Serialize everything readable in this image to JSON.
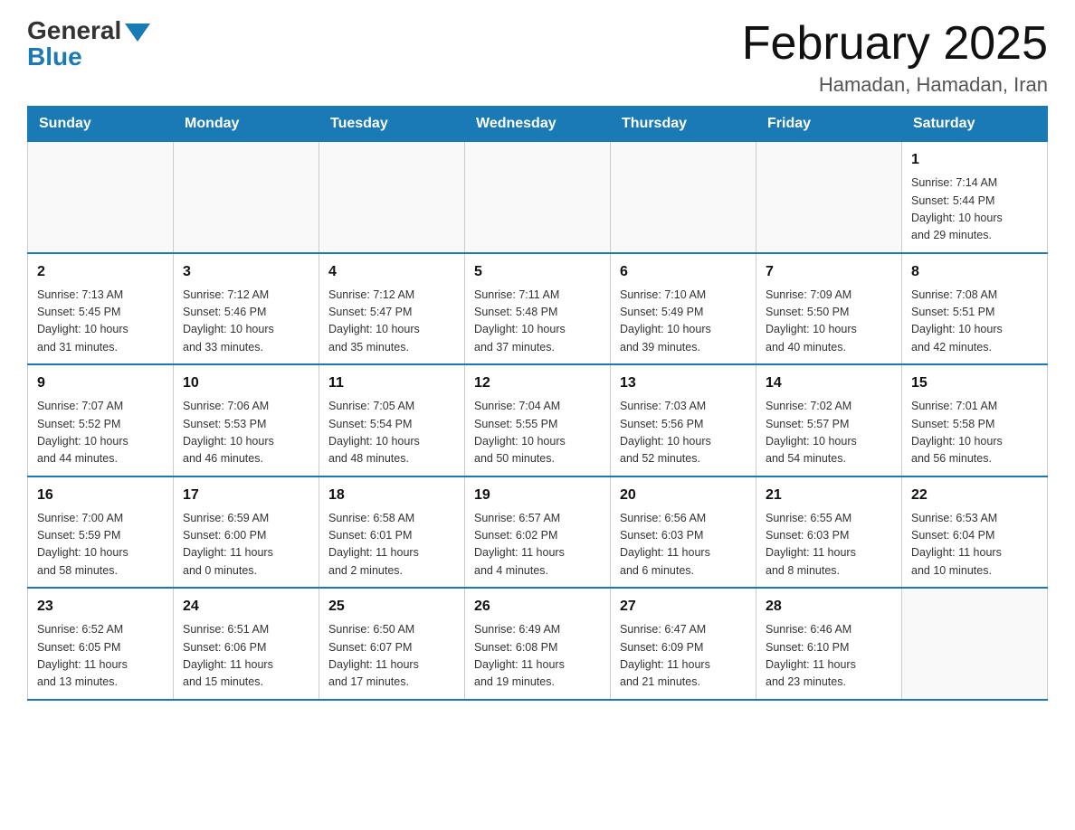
{
  "header": {
    "logo_general": "General",
    "logo_blue": "Blue",
    "month_title": "February 2025",
    "location": "Hamadan, Hamadan, Iran"
  },
  "days_of_week": [
    "Sunday",
    "Monday",
    "Tuesday",
    "Wednesday",
    "Thursday",
    "Friday",
    "Saturday"
  ],
  "weeks": [
    [
      {
        "day": "",
        "info": ""
      },
      {
        "day": "",
        "info": ""
      },
      {
        "day": "",
        "info": ""
      },
      {
        "day": "",
        "info": ""
      },
      {
        "day": "",
        "info": ""
      },
      {
        "day": "",
        "info": ""
      },
      {
        "day": "1",
        "info": "Sunrise: 7:14 AM\nSunset: 5:44 PM\nDaylight: 10 hours\nand 29 minutes."
      }
    ],
    [
      {
        "day": "2",
        "info": "Sunrise: 7:13 AM\nSunset: 5:45 PM\nDaylight: 10 hours\nand 31 minutes."
      },
      {
        "day": "3",
        "info": "Sunrise: 7:12 AM\nSunset: 5:46 PM\nDaylight: 10 hours\nand 33 minutes."
      },
      {
        "day": "4",
        "info": "Sunrise: 7:12 AM\nSunset: 5:47 PM\nDaylight: 10 hours\nand 35 minutes."
      },
      {
        "day": "5",
        "info": "Sunrise: 7:11 AM\nSunset: 5:48 PM\nDaylight: 10 hours\nand 37 minutes."
      },
      {
        "day": "6",
        "info": "Sunrise: 7:10 AM\nSunset: 5:49 PM\nDaylight: 10 hours\nand 39 minutes."
      },
      {
        "day": "7",
        "info": "Sunrise: 7:09 AM\nSunset: 5:50 PM\nDaylight: 10 hours\nand 40 minutes."
      },
      {
        "day": "8",
        "info": "Sunrise: 7:08 AM\nSunset: 5:51 PM\nDaylight: 10 hours\nand 42 minutes."
      }
    ],
    [
      {
        "day": "9",
        "info": "Sunrise: 7:07 AM\nSunset: 5:52 PM\nDaylight: 10 hours\nand 44 minutes."
      },
      {
        "day": "10",
        "info": "Sunrise: 7:06 AM\nSunset: 5:53 PM\nDaylight: 10 hours\nand 46 minutes."
      },
      {
        "day": "11",
        "info": "Sunrise: 7:05 AM\nSunset: 5:54 PM\nDaylight: 10 hours\nand 48 minutes."
      },
      {
        "day": "12",
        "info": "Sunrise: 7:04 AM\nSunset: 5:55 PM\nDaylight: 10 hours\nand 50 minutes."
      },
      {
        "day": "13",
        "info": "Sunrise: 7:03 AM\nSunset: 5:56 PM\nDaylight: 10 hours\nand 52 minutes."
      },
      {
        "day": "14",
        "info": "Sunrise: 7:02 AM\nSunset: 5:57 PM\nDaylight: 10 hours\nand 54 minutes."
      },
      {
        "day": "15",
        "info": "Sunrise: 7:01 AM\nSunset: 5:58 PM\nDaylight: 10 hours\nand 56 minutes."
      }
    ],
    [
      {
        "day": "16",
        "info": "Sunrise: 7:00 AM\nSunset: 5:59 PM\nDaylight: 10 hours\nand 58 minutes."
      },
      {
        "day": "17",
        "info": "Sunrise: 6:59 AM\nSunset: 6:00 PM\nDaylight: 11 hours\nand 0 minutes."
      },
      {
        "day": "18",
        "info": "Sunrise: 6:58 AM\nSunset: 6:01 PM\nDaylight: 11 hours\nand 2 minutes."
      },
      {
        "day": "19",
        "info": "Sunrise: 6:57 AM\nSunset: 6:02 PM\nDaylight: 11 hours\nand 4 minutes."
      },
      {
        "day": "20",
        "info": "Sunrise: 6:56 AM\nSunset: 6:03 PM\nDaylight: 11 hours\nand 6 minutes."
      },
      {
        "day": "21",
        "info": "Sunrise: 6:55 AM\nSunset: 6:03 PM\nDaylight: 11 hours\nand 8 minutes."
      },
      {
        "day": "22",
        "info": "Sunrise: 6:53 AM\nSunset: 6:04 PM\nDaylight: 11 hours\nand 10 minutes."
      }
    ],
    [
      {
        "day": "23",
        "info": "Sunrise: 6:52 AM\nSunset: 6:05 PM\nDaylight: 11 hours\nand 13 minutes."
      },
      {
        "day": "24",
        "info": "Sunrise: 6:51 AM\nSunset: 6:06 PM\nDaylight: 11 hours\nand 15 minutes."
      },
      {
        "day": "25",
        "info": "Sunrise: 6:50 AM\nSunset: 6:07 PM\nDaylight: 11 hours\nand 17 minutes."
      },
      {
        "day": "26",
        "info": "Sunrise: 6:49 AM\nSunset: 6:08 PM\nDaylight: 11 hours\nand 19 minutes."
      },
      {
        "day": "27",
        "info": "Sunrise: 6:47 AM\nSunset: 6:09 PM\nDaylight: 11 hours\nand 21 minutes."
      },
      {
        "day": "28",
        "info": "Sunrise: 6:46 AM\nSunset: 6:10 PM\nDaylight: 11 hours\nand 23 minutes."
      },
      {
        "day": "",
        "info": ""
      }
    ]
  ]
}
